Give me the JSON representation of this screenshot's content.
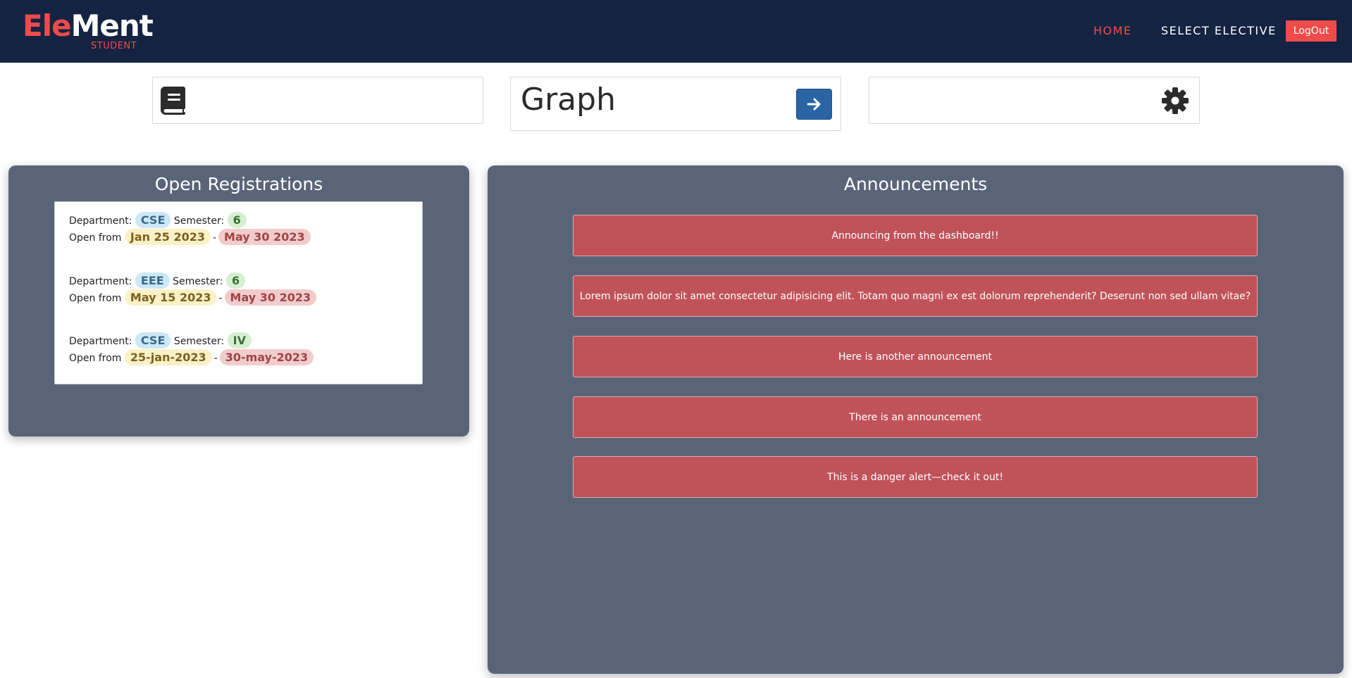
{
  "navbar": {
    "brand_part1": "Ele",
    "brand_part2": "Ment",
    "brand_sub": "STUDENT",
    "links": [
      {
        "label": "HOME",
        "active": true
      },
      {
        "label": "SELECT ELECTIVE",
        "active": false
      }
    ],
    "logout_label": "LogOut",
    "bg_color": "#142341",
    "accent_color": "#ef4b4b"
  },
  "cards": {
    "card1_icon": "book-icon",
    "card2_title": "Graph",
    "card2_button_icon": "arrow-right-icon",
    "card3_icon": "gear-icon"
  },
  "registrations": {
    "title": "Open Registrations",
    "items": [
      {
        "dept_label": "Department:",
        "dept": "CSE",
        "sem_label": "Semester:",
        "sem": "6",
        "open_label": "Open from",
        "from": "Jan 25 2023",
        "to": "May 30 2023"
      },
      {
        "dept_label": "Department:",
        "dept": "EEE",
        "sem_label": "Semester:",
        "sem": "6",
        "open_label": "Open from",
        "from": "May 15 2023",
        "to": "May 30 2023"
      },
      {
        "dept_label": "Department:",
        "dept": "CSE",
        "sem_label": "Semester:",
        "sem": "IV",
        "open_label": "Open from",
        "from": "25-jan-2023",
        "to": "30-may-2023"
      }
    ],
    "separator": "-"
  },
  "announcements": {
    "title": "Announcements",
    "items": [
      "Announcing from the dashboard!!",
      "Lorem ipsum dolor sit amet consectetur adipisicing elit. Totam quo magni ex est dolorum reprehenderit? Deserunt non sed ullam vitae?",
      "Here is another announcement",
      "There is an announcement",
      "This is a danger alert—check it out!"
    ],
    "alert_color": "#c0525a"
  }
}
